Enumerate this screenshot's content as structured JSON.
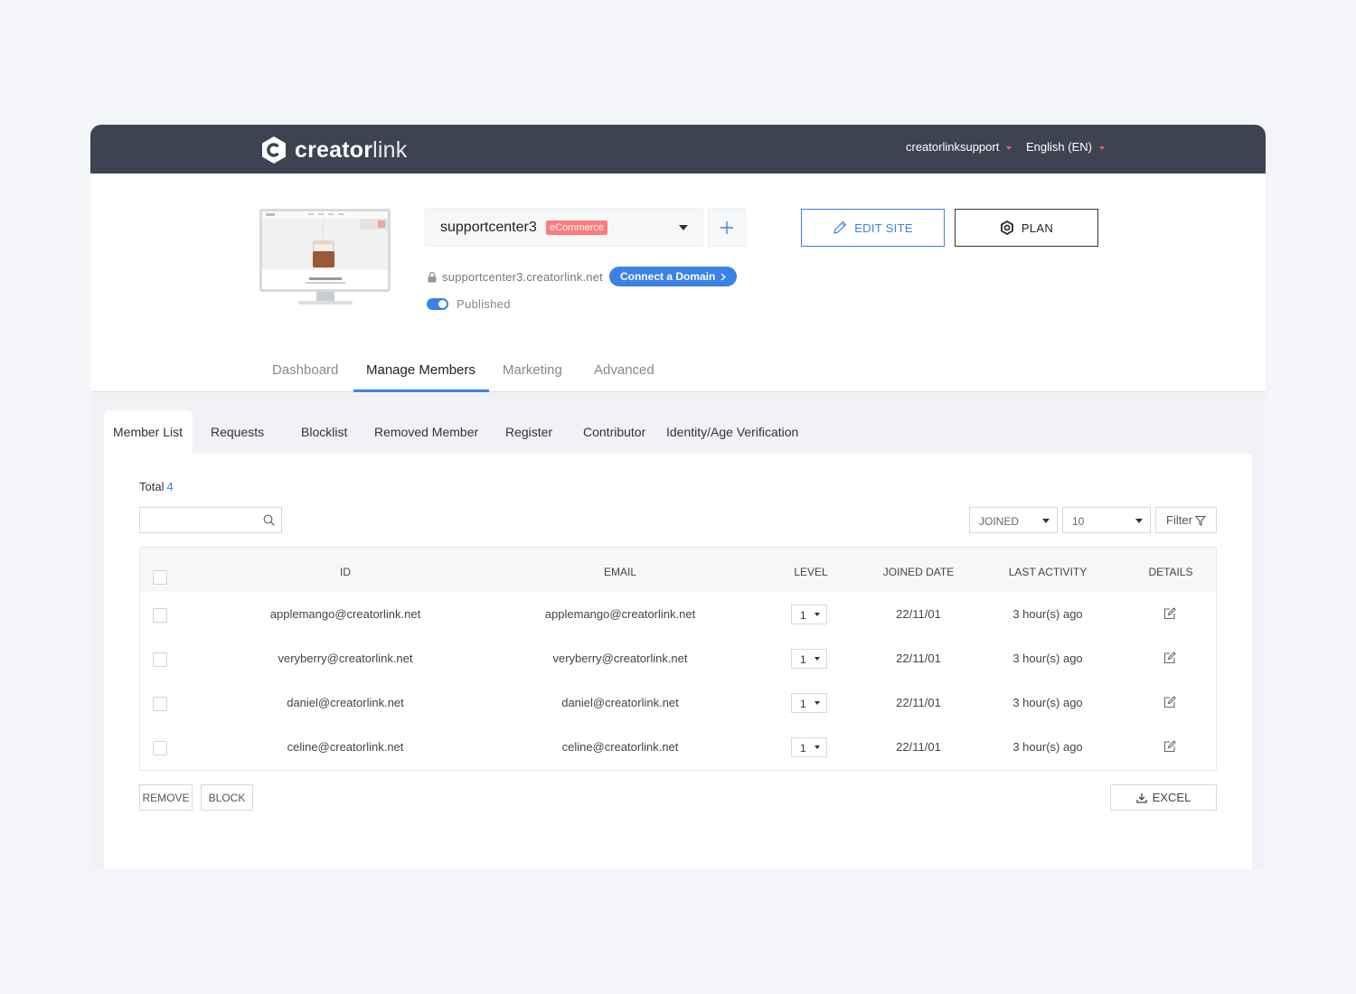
{
  "brand": {
    "name_bold": "creator",
    "name_light": "link"
  },
  "topbar": {
    "account": "creatorlinksupport",
    "language": "English (EN)"
  },
  "site": {
    "name": "supportcenter3",
    "badge": "eCommerce",
    "url": "supportcenter3.creatorlink.net",
    "connect_label": "Connect a Domain",
    "status": "Published",
    "edit_label": "EDIT SITE",
    "plan_label": "PLAN"
  },
  "main_tabs": [
    {
      "label": "Dashboard"
    },
    {
      "label": "Manage Members"
    },
    {
      "label": "Marketing"
    },
    {
      "label": "Advanced"
    }
  ],
  "sub_tabs": [
    {
      "label": "Member List"
    },
    {
      "label": "Requests"
    },
    {
      "label": "Blocklist"
    },
    {
      "label": "Removed Member"
    },
    {
      "label": "Register"
    },
    {
      "label": "Contributor"
    },
    {
      "label": "Identity/Age Verification"
    }
  ],
  "members": {
    "total_label": "Total",
    "total_count": "4",
    "search_placeholder": "",
    "sort_value": "JOINED",
    "page_size": "10",
    "filter_label": "Filter",
    "columns": [
      "ID",
      "EMAIL",
      "LEVEL",
      "JOINED DATE",
      "LAST ACTIVITY",
      "DETAILS"
    ],
    "rows": [
      {
        "id": "applemango@creatorlink.net",
        "email": "applemango@creatorlink.net",
        "level": "1",
        "joined": "22/11/01",
        "last_activity": "3 hour(s) ago"
      },
      {
        "id": "veryberry@creatorlink.net",
        "email": "veryberry@creatorlink.net",
        "level": "1",
        "joined": "22/11/01",
        "last_activity": "3 hour(s) ago"
      },
      {
        "id": "daniel@creatorlink.net",
        "email": "daniel@creatorlink.net",
        "level": "1",
        "joined": "22/11/01",
        "last_activity": "3 hour(s) ago"
      },
      {
        "id": "celine@creatorlink.net",
        "email": "celine@creatorlink.net",
        "level": "1",
        "joined": "22/11/01",
        "last_activity": "3 hour(s) ago"
      }
    ],
    "remove_label": "REMOVE",
    "block_label": "BLOCK",
    "excel_label": "EXCEL"
  },
  "colors": {
    "topbar": "#3d4350",
    "accent": "#3b82e6",
    "badge": "#ff7a7a",
    "content_bg": "#f1f2f5"
  },
  "icons": [
    "logo-icon",
    "caret-down-icon",
    "plus-icon",
    "lock-icon",
    "chevron-right-icon",
    "pencil-icon",
    "gear-icon",
    "search-icon",
    "filter-icon",
    "edit-icon",
    "download-icon"
  ]
}
